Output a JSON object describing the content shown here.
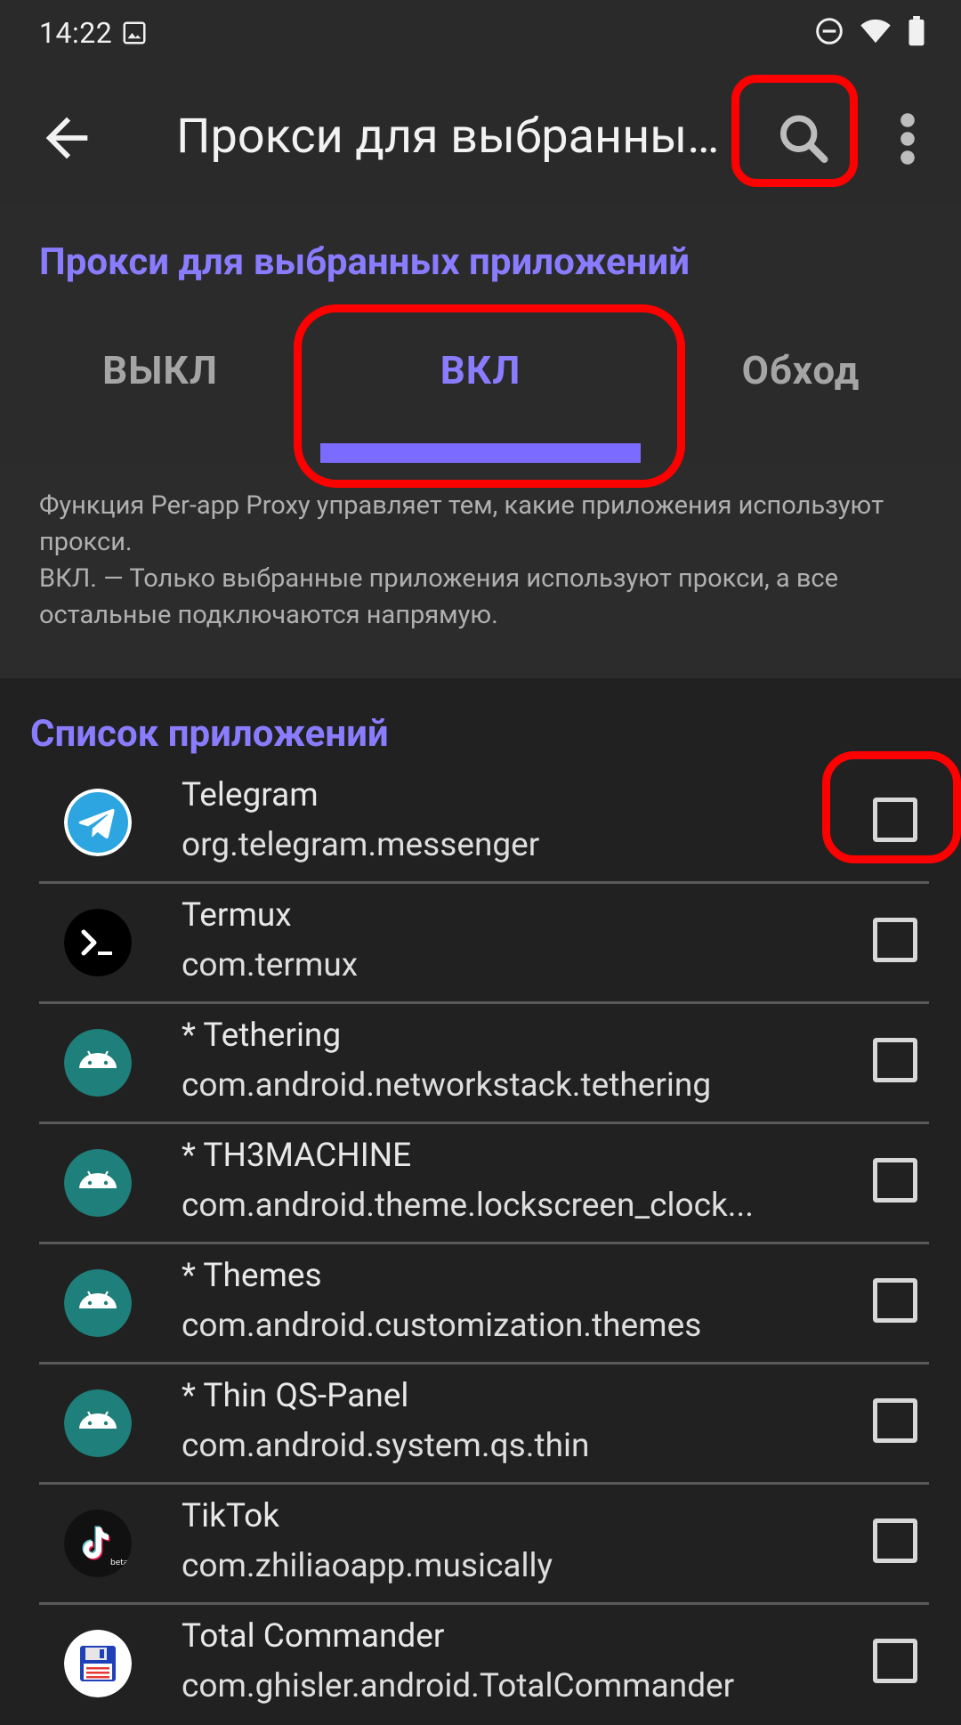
{
  "status_bar": {
    "time": "14:22",
    "icons": [
      "image-icon",
      "dnd-icon",
      "wifi-icon",
      "battery-icon"
    ]
  },
  "app_bar": {
    "title": "Прокси для выбранных приложений",
    "back_icon": "arrow-left-icon",
    "search_icon": "search-icon",
    "more_icon": "more-vert-icon"
  },
  "mode": {
    "title": "Прокси для выбранных приложений",
    "tabs": [
      {
        "label": "ВЫКЛ",
        "selected": false
      },
      {
        "label": "ВКЛ",
        "selected": true
      },
      {
        "label": "Обход",
        "selected": false
      }
    ]
  },
  "description": "Функция Per-app Proxy управляет тем, какие приложения используют прокси.\nВКЛ. — Только выбранные приложения используют прокси, а все остальные подключаются напрямую.",
  "app_list": {
    "title": "Список приложений",
    "items": [
      {
        "name": "Telegram",
        "package": "org.telegram.messenger",
        "icon": "telegram-icon",
        "checked": false
      },
      {
        "name": "Termux",
        "package": "com.termux",
        "icon": "termux-icon",
        "checked": false
      },
      {
        "name": "* Tethering",
        "package": "com.android.networkstack.tethering",
        "icon": "android-icon",
        "checked": false
      },
      {
        "name": "* TH3MACHINE",
        "package": "com.android.theme.lockscreen_clock...",
        "icon": "android-icon",
        "checked": false
      },
      {
        "name": "* Themes",
        "package": "com.android.customization.themes",
        "icon": "android-icon",
        "checked": false
      },
      {
        "name": "* Thin QS-Panel",
        "package": "com.android.system.qs.thin",
        "icon": "android-icon",
        "checked": false
      },
      {
        "name": "TikTok",
        "package": "com.zhiliaoapp.musically",
        "icon": "tiktok-icon",
        "checked": false
      },
      {
        "name": "Total Commander",
        "package": "com.ghisler.android.TotalCommander",
        "icon": "total-commander-icon",
        "checked": false
      }
    ]
  },
  "colors": {
    "accent": "#8a7cff",
    "highlight": "#ff0000",
    "background": "#212121"
  }
}
